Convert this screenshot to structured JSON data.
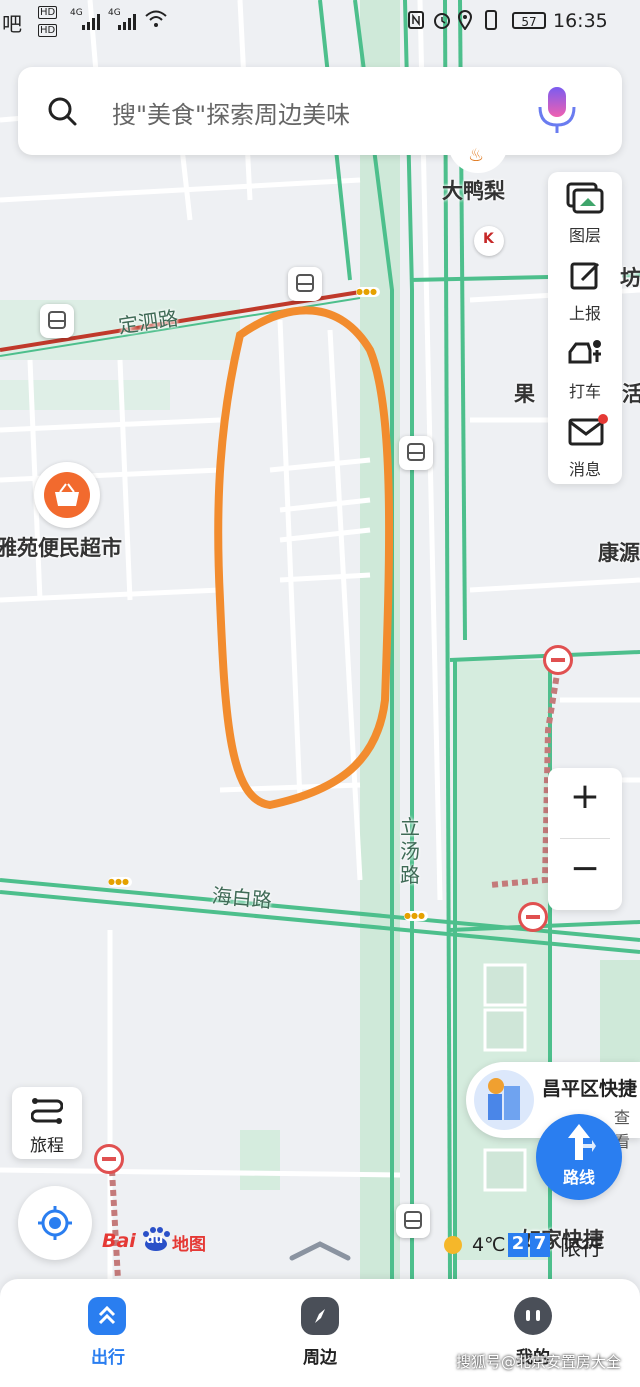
{
  "status_bar": {
    "left_text": "吧",
    "network_1": "HD",
    "network_2": "HD",
    "signal_1": "4G",
    "signal_2": "4G",
    "battery": "57",
    "time": "16:35"
  },
  "search": {
    "placeholder": "搜\"美食\"探索周边美味",
    "voice_icon": "mic-icon"
  },
  "right_panel": {
    "items": [
      {
        "label": "图层",
        "icon": "layers-icon"
      },
      {
        "label": "上报",
        "icon": "report-icon"
      },
      {
        "label": "打车",
        "icon": "taxi-icon"
      },
      {
        "label": "消息",
        "icon": "mail-icon"
      }
    ]
  },
  "zoom": {
    "in": "+",
    "out": "−"
  },
  "map_labels": {
    "poi_duck": "大鸭梨",
    "poi_market": "雅苑便民超市",
    "poi_guo": "果",
    "poi_kang": "康源",
    "poi_huo": "活",
    "poi_fang": "坊",
    "road_dingsi": "定泗路",
    "road_haibai": "海白路",
    "road_litang": "立汤路",
    "poi_bottom": "如家快捷"
  },
  "featured_poi": {
    "name": "昌平区快捷",
    "sub": "查看"
  },
  "trip_button": "旅程",
  "route_button": "路线",
  "logo": {
    "bai": "Bai",
    "du": "du",
    "map": "地图"
  },
  "weather": {
    "temp": "4℃",
    "restrict_1": "2",
    "restrict_2": "7",
    "restrict_label": "限行"
  },
  "bottom_tabs": [
    {
      "label": "出行",
      "icon": "travel-icon",
      "active": true
    },
    {
      "label": "周边",
      "icon": "compass-icon",
      "active": false
    },
    {
      "label": "我的",
      "icon": "profile-icon",
      "active": false
    }
  ],
  "watermark": "搜狐号@北京安置房大全",
  "colors": {
    "accent": "#2a7ef0",
    "highlight": "#f28c2e",
    "road_green": "#4dbf8c",
    "road_red": "#c0392b"
  }
}
